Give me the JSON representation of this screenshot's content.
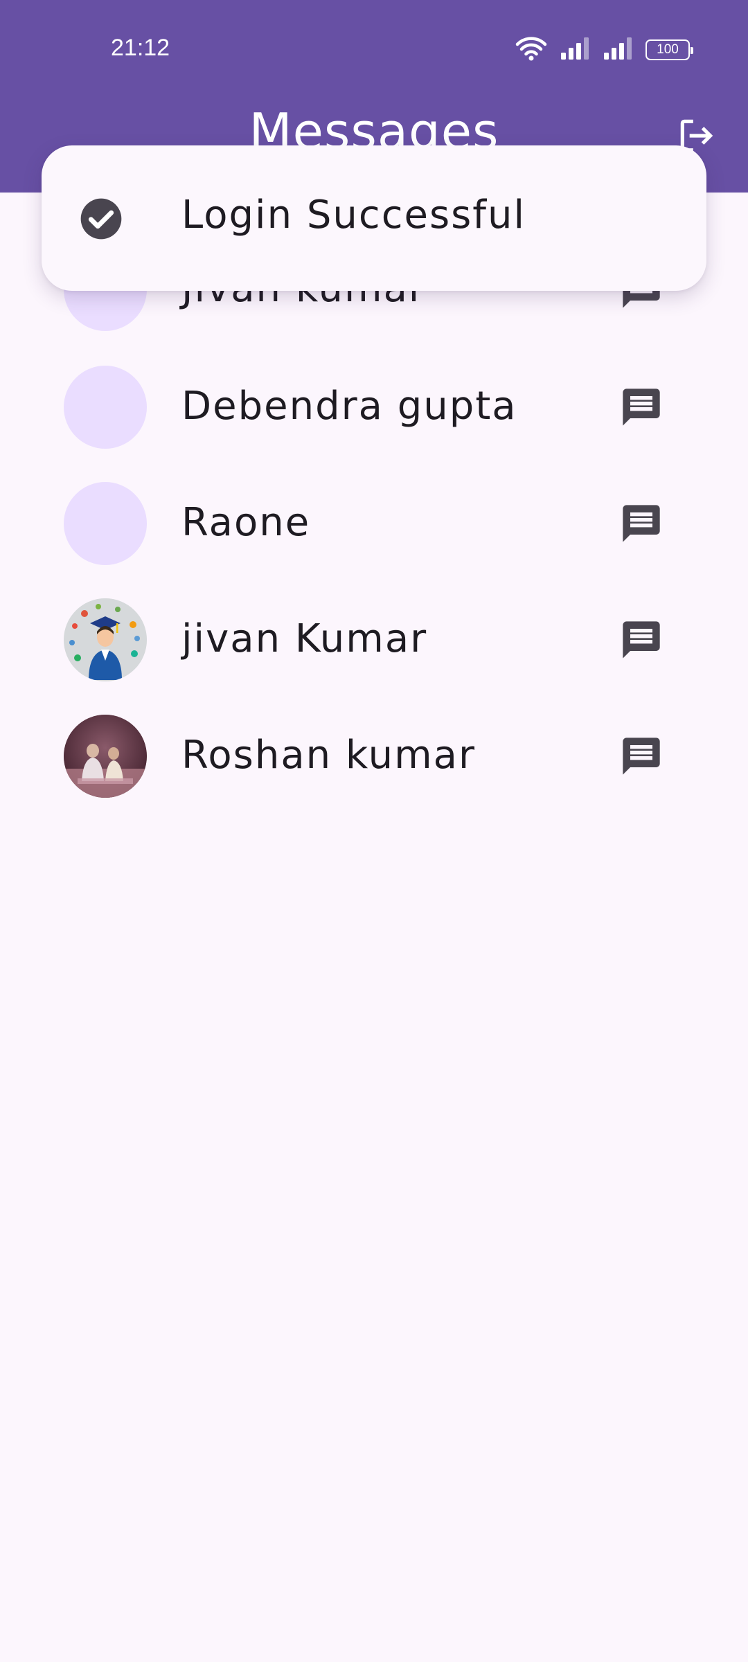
{
  "status_bar": {
    "time": "21:12",
    "battery": "100",
    "icons": [
      "wifi-icon",
      "signal-icon",
      "signal-icon",
      "battery-icon"
    ]
  },
  "header": {
    "title": "Messages",
    "logout_icon": "logout-icon",
    "color": "#6750a4"
  },
  "contacts": [
    {
      "name": "Jivan kumar",
      "avatar": "placeholder",
      "action_icon": "chat-icon"
    },
    {
      "name": "Debendra gupta",
      "avatar": "placeholder",
      "action_icon": "chat-icon"
    },
    {
      "name": "Raone",
      "avatar": "placeholder",
      "action_icon": "chat-icon"
    },
    {
      "name": "jivan Kumar",
      "avatar": "photo-graduate",
      "action_icon": "chat-icon"
    },
    {
      "name": "Roshan kumar",
      "avatar": "photo-people",
      "action_icon": "chat-icon"
    }
  ],
  "toast": {
    "message": "Login Successful",
    "icon": "check-circle-icon"
  }
}
